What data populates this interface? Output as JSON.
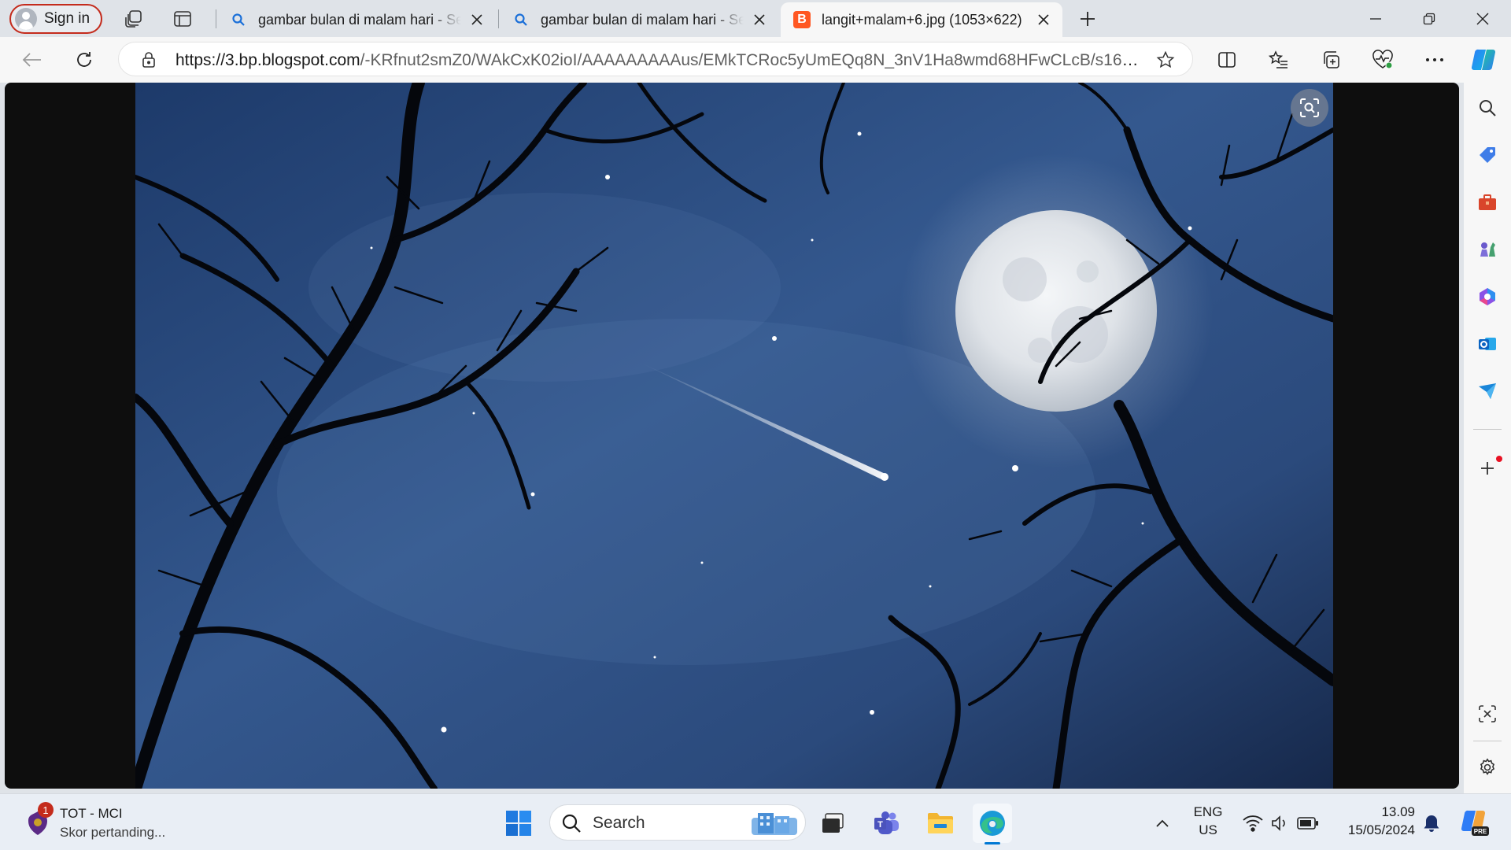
{
  "tabs_bar": {
    "signin_label": "Sign in",
    "tabs": [
      {
        "title": "gambar bulan di malam hari - Search",
        "icon": "search-icon"
      },
      {
        "title": "gambar bulan di malam hari - Search",
        "icon": "search-icon"
      },
      {
        "title": "langit+malam+6.jpg (1053×622)",
        "icon": "blogger-icon"
      }
    ],
    "blogger_letter": "B"
  },
  "address_bar": {
    "url_host": "https://3.bp.blogspot.com",
    "url_path": "/-KRfnut2smZ0/WAkCxK02ioI/AAAAAAAAAus/EMkTCRoc5yUmEQq8N_3nV1Ha8wmd68HFwCLcB/s1600/l..."
  },
  "taskbar": {
    "widget": {
      "badge": "1",
      "title": "TOT - MCI",
      "subtitle": "Skor pertanding..."
    },
    "search_label": "Search",
    "language": {
      "line1": "ENG",
      "line2": "US"
    },
    "clock": {
      "time": "13.09",
      "date": "15/05/2024"
    }
  },
  "colors": {
    "accent": "#0078d4",
    "signin_border": "#c42b1c",
    "blogger": "#ff5722",
    "notification_dot": "#e81123"
  }
}
